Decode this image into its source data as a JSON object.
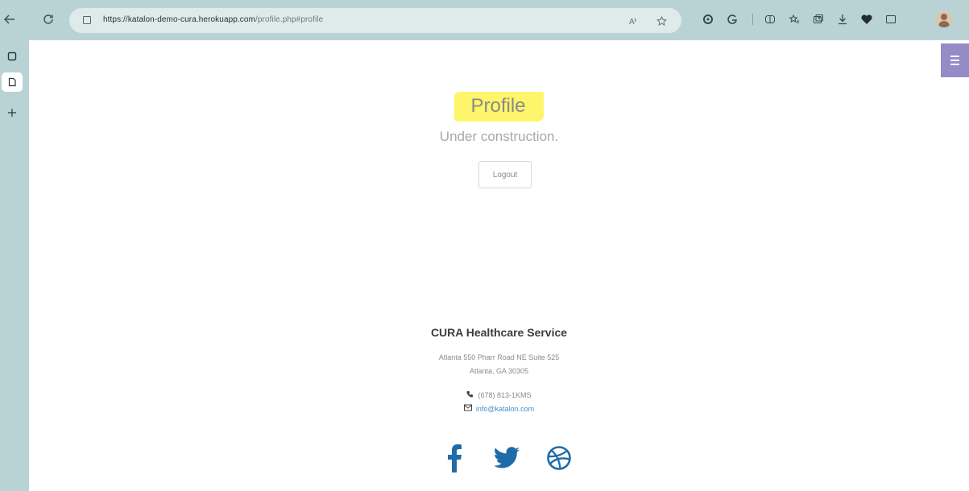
{
  "browser": {
    "url_host": "https://katalon-demo-cura.herokuapp.com",
    "url_path": "/profile.php#profile",
    "nav": {
      "back_icon": "back-arrow-icon",
      "refresh_icon": "refresh-icon"
    },
    "extensions": [
      "read-aloud-icon",
      "favorite-star-icon",
      "extension-circle-icon",
      "extension-g-icon",
      "split-screen-icon",
      "favorites-icon",
      "collections-icon",
      "downloads-icon",
      "extension-heart-icon",
      "profile-avatar"
    ]
  },
  "sidebar": {
    "tabs": [
      "tab-actions-icon",
      "page-tab-icon",
      "new-tab-icon"
    ]
  },
  "page": {
    "title": "Profile",
    "subtitle": "Under construction.",
    "logout_label": "Logout",
    "highlight_color": "#fdf56a",
    "menu_color": "#958bc7"
  },
  "footer": {
    "company": "CURA Healthcare Service",
    "address_line1": "Atlanta 550 Pharr Road NE Suite 525",
    "address_line2": "Atlanta, GA 30305",
    "phone": "(678) 813-1KMS",
    "email": "info@katalon.com",
    "social": [
      "facebook-icon",
      "twitter-icon",
      "dribbble-icon"
    ],
    "social_color": "#1e6ba9"
  }
}
